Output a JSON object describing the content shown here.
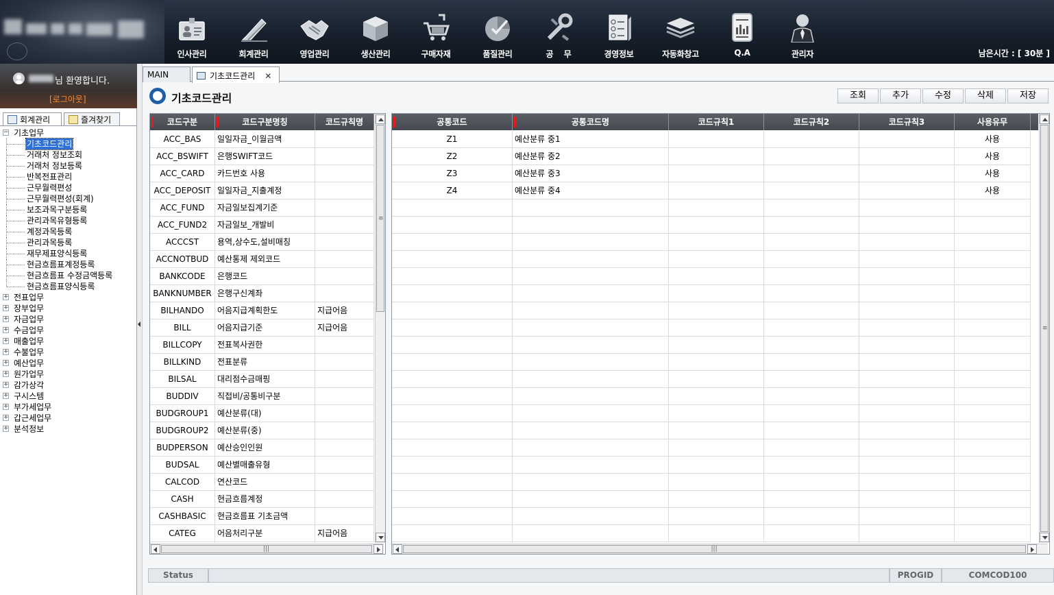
{
  "header": {
    "nav": [
      {
        "label": "인사관리",
        "icon": "id-card-icon"
      },
      {
        "label": "회계관리",
        "icon": "pen-icon"
      },
      {
        "label": "영업관리",
        "icon": "handshake-icon"
      },
      {
        "label": "생산관리",
        "icon": "box-icon"
      },
      {
        "label": "구매자재",
        "icon": "shopping-cart-icon"
      },
      {
        "label": "품질관리",
        "icon": "pie-check-icon"
      },
      {
        "label": "공    무",
        "icon": "wrench-icon"
      },
      {
        "label": "경영정보",
        "icon": "checklist-icon"
      },
      {
        "label": "자동화창고",
        "icon": "layers-icon"
      },
      {
        "label": "Q.A",
        "icon": "report-icon"
      },
      {
        "label": "관리자",
        "icon": "admin-user-icon"
      }
    ],
    "timer": "남은시간 : [ 30분 ]"
  },
  "sidebar": {
    "welcome": "님 환영합니다.",
    "logout": "[로그아웃]",
    "tabs": [
      "회계관리",
      "즐겨찾기"
    ],
    "tree": [
      {
        "label": "기초업무",
        "expanded": true,
        "children": [
          {
            "label": "기초코드관리",
            "selected": true
          },
          {
            "label": "거래처 정보조회"
          },
          {
            "label": "거래처 정보등록"
          },
          {
            "label": "반복전표관리"
          },
          {
            "label": "근무월력편성"
          },
          {
            "label": "근무월력편성(회계)"
          },
          {
            "label": "보조과목구분등록"
          },
          {
            "label": "관리과목유형등록"
          },
          {
            "label": "계정과목등록"
          },
          {
            "label": "관리과목등록"
          },
          {
            "label": "재무제표양식등록"
          },
          {
            "label": "현금흐름표계정등록"
          },
          {
            "label": "현금흐름표 수정금액등록"
          },
          {
            "label": "현금흐름표양식등록"
          }
        ]
      },
      {
        "label": "전표업무"
      },
      {
        "label": "장부업무"
      },
      {
        "label": "자금업무"
      },
      {
        "label": "수금업무"
      },
      {
        "label": "매출업무"
      },
      {
        "label": "수불업무"
      },
      {
        "label": "예산업무"
      },
      {
        "label": "원가업무"
      },
      {
        "label": "감가상각"
      },
      {
        "label": "구시스템"
      },
      {
        "label": "부가세업무"
      },
      {
        "label": "갑근세업무"
      },
      {
        "label": "분석정보"
      }
    ]
  },
  "tabs": {
    "main": "MAIN",
    "active": "기초코드관리",
    "close": "✕"
  },
  "page": {
    "title": "기초코드관리",
    "actions": [
      "조회",
      "추가",
      "수정",
      "삭제",
      "저장"
    ]
  },
  "left_grid": {
    "columns": [
      "코드구분",
      "코드구분명칭",
      "코드규칙명"
    ],
    "rows": [
      [
        "ACC_BAS",
        "일일자금_이월금액",
        ""
      ],
      [
        "ACC_BSWIFT",
        "은행SWIFT코드",
        ""
      ],
      [
        "ACC_CARD",
        "카드번호 사용",
        ""
      ],
      [
        "ACC_DEPOSIT",
        "일일자금_지출계정",
        ""
      ],
      [
        "ACC_FUND",
        "자금일보집계기준",
        ""
      ],
      [
        "ACC_FUND2",
        "자금일보_개발비",
        ""
      ],
      [
        "ACCCST",
        "용역,상수도,설비매칭",
        ""
      ],
      [
        "ACCNOTBUD",
        "예산통제 제외코드",
        ""
      ],
      [
        "BANKCODE",
        "은행코드",
        ""
      ],
      [
        "BANKNUMBER",
        "은행구신계좌",
        ""
      ],
      [
        "BILHANDO",
        "어음지급계획한도",
        "지급어음"
      ],
      [
        "BILL",
        "어음지급기준",
        "지급어음"
      ],
      [
        "BILLCOPY",
        "전표복사권한",
        ""
      ],
      [
        "BILLKIND",
        "전표분류",
        ""
      ],
      [
        "BILSAL",
        "대리점수금매핑",
        ""
      ],
      [
        "BUDDIV",
        "직접비/공통비구분",
        ""
      ],
      [
        "BUDGROUP1",
        "예산분류(대)",
        ""
      ],
      [
        "BUDGROUP2",
        "예산분류(중)",
        ""
      ],
      [
        "BUDPERSON",
        "예산승인인원",
        ""
      ],
      [
        "BUDSAL",
        "예산별매출유형",
        ""
      ],
      [
        "CALCOD",
        "연산코드",
        ""
      ],
      [
        "CASH",
        "현금흐름계정",
        ""
      ],
      [
        "CASHBASIC",
        "현금흐름표 기초금액",
        ""
      ],
      [
        "CATEG",
        "어음처리구분",
        "지급어음"
      ]
    ]
  },
  "right_grid": {
    "columns": [
      "공통코드",
      "공통코드명",
      "코드규칙1",
      "코드규칙2",
      "코드규칙3",
      "사용유무"
    ],
    "rows": [
      [
        "Z1",
        "예산분류 중1",
        "",
        "",
        "",
        "사용"
      ],
      [
        "Z2",
        "예산분류 중2",
        "",
        "",
        "",
        "사용"
      ],
      [
        "Z3",
        "예산분류 중3",
        "",
        "",
        "",
        "사용"
      ],
      [
        "Z4",
        "예산분류 중4",
        "",
        "",
        "",
        "사용"
      ]
    ],
    "empty_rows": 20
  },
  "statusbar": {
    "status": "Status",
    "message": "",
    "progid_label": "PROGID",
    "progid_value": "COMCOD100"
  },
  "colors": {
    "header_bg": "#17202c",
    "grid_header": "#4f545b",
    "required_marker": "#e21c1c",
    "selection": "#2c6fd6",
    "logout": "#ff8a2a",
    "title_icon": "#1f5fa6"
  }
}
